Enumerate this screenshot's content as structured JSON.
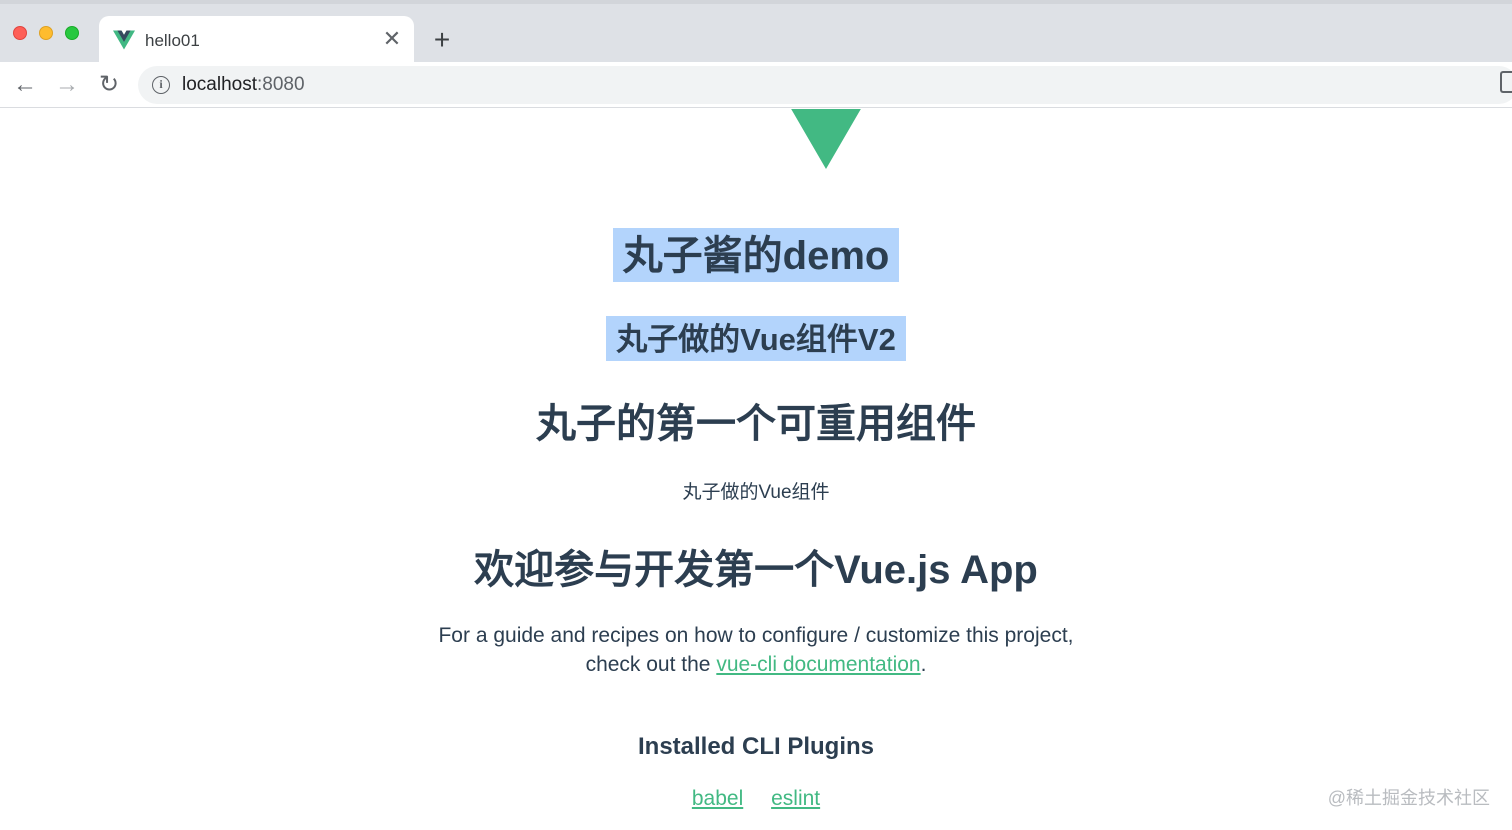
{
  "browser": {
    "tab": {
      "title": "hello01",
      "favicon": "vue-logo-icon",
      "close_glyph": "✕"
    },
    "new_tab_glyph": "+",
    "toolbar": {
      "back_glyph": "←",
      "forward_glyph": "→",
      "reload_glyph": "↻",
      "info_glyph": "i",
      "url_host": "localhost",
      "url_port": ":8080"
    }
  },
  "page": {
    "logo": "vue-logo-icon",
    "headings": {
      "demo": "丸子酱的demo",
      "v2": "丸子做的Vue组件V2",
      "reusable": "丸子的第一个可重用组件",
      "made_by": "丸子做的Vue组件",
      "welcome": "欢迎参与开发第一个Vue.js App"
    },
    "guide": {
      "line1": "For a guide and recipes on how to configure / customize this project,",
      "line2_prefix": "check out the ",
      "link": "vue-cli documentation",
      "line2_suffix": "."
    },
    "plugins": {
      "heading": "Installed CLI Plugins",
      "items": [
        "babel",
        "eslint"
      ]
    },
    "watermark": "@稀土掘金技术社区"
  },
  "colors": {
    "vue_green": "#42b983",
    "vue_dark": "#35495e",
    "text": "#2c3e50",
    "selection": "#b3d4fc",
    "tabstrip": "#dee1e6"
  }
}
